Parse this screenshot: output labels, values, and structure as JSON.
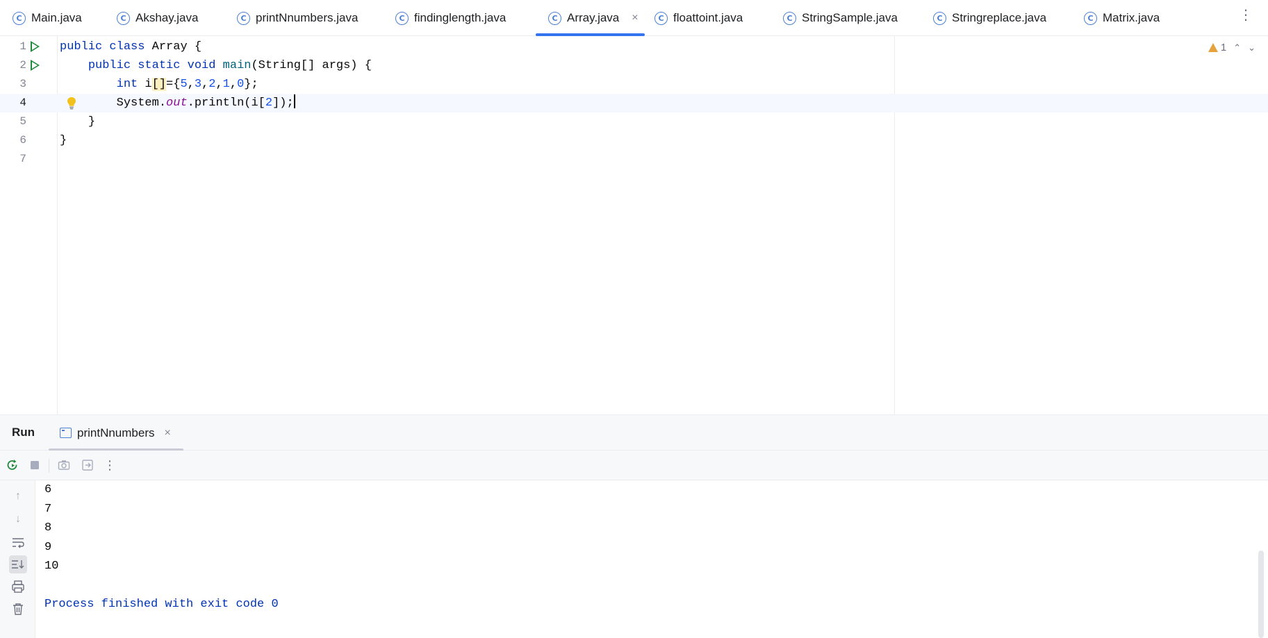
{
  "tabs": [
    {
      "label": "Main.java",
      "active": false
    },
    {
      "label": "Akshay.java",
      "active": false
    },
    {
      "label": "printNnumbers.java",
      "active": false
    },
    {
      "label": "findinglength.java",
      "active": false
    },
    {
      "label": "Array.java",
      "active": true
    },
    {
      "label": "floattoint.java",
      "active": false
    },
    {
      "label": "StringSample.java",
      "active": false
    },
    {
      "label": "Stringreplace.java",
      "active": false
    },
    {
      "label": "Matrix.java",
      "active": false
    }
  ],
  "tab_close_glyph": "×",
  "more_glyph": "⋮",
  "editor": {
    "line_numbers": [
      "1",
      "2",
      "3",
      "4",
      "5",
      "6",
      "7"
    ],
    "current_line": 4,
    "lines": {
      "l1_kw1": "public",
      "l1_kw2": "class",
      "l1_rest": " Array {",
      "l2_kw1": "public",
      "l2_kw2": "static",
      "l2_kw3": "void",
      "l2_fn": "main",
      "l2_rest": "(String[] args) {",
      "l3_kw": "int",
      "l3_var": " i",
      "l3_br": "[]",
      "l3_eq": "={",
      "n5": "5",
      "n3": "3",
      "n2": "2",
      "n1": "1",
      "n0": "0",
      "l3_end": "};",
      "l4_a": "System.",
      "l4_fld": "out",
      "l4_b": ".println(i[",
      "l4_num": "2",
      "l4_c": "]);",
      "l5": "}",
      "l6": "}"
    },
    "inspection": {
      "warning_count": "1",
      "up": "⌃",
      "down": "⌄"
    }
  },
  "run": {
    "title": "Run",
    "tab_label": "printNnumbers",
    "tab_close": "×",
    "output": [
      "6",
      "7",
      "8",
      "9",
      "10",
      "",
      "Process finished with exit code 0"
    ]
  },
  "colors": {
    "accent": "#3574f0",
    "run_green": "#208a3c",
    "keyword": "#0033b3",
    "warning": "#e6a23c"
  }
}
